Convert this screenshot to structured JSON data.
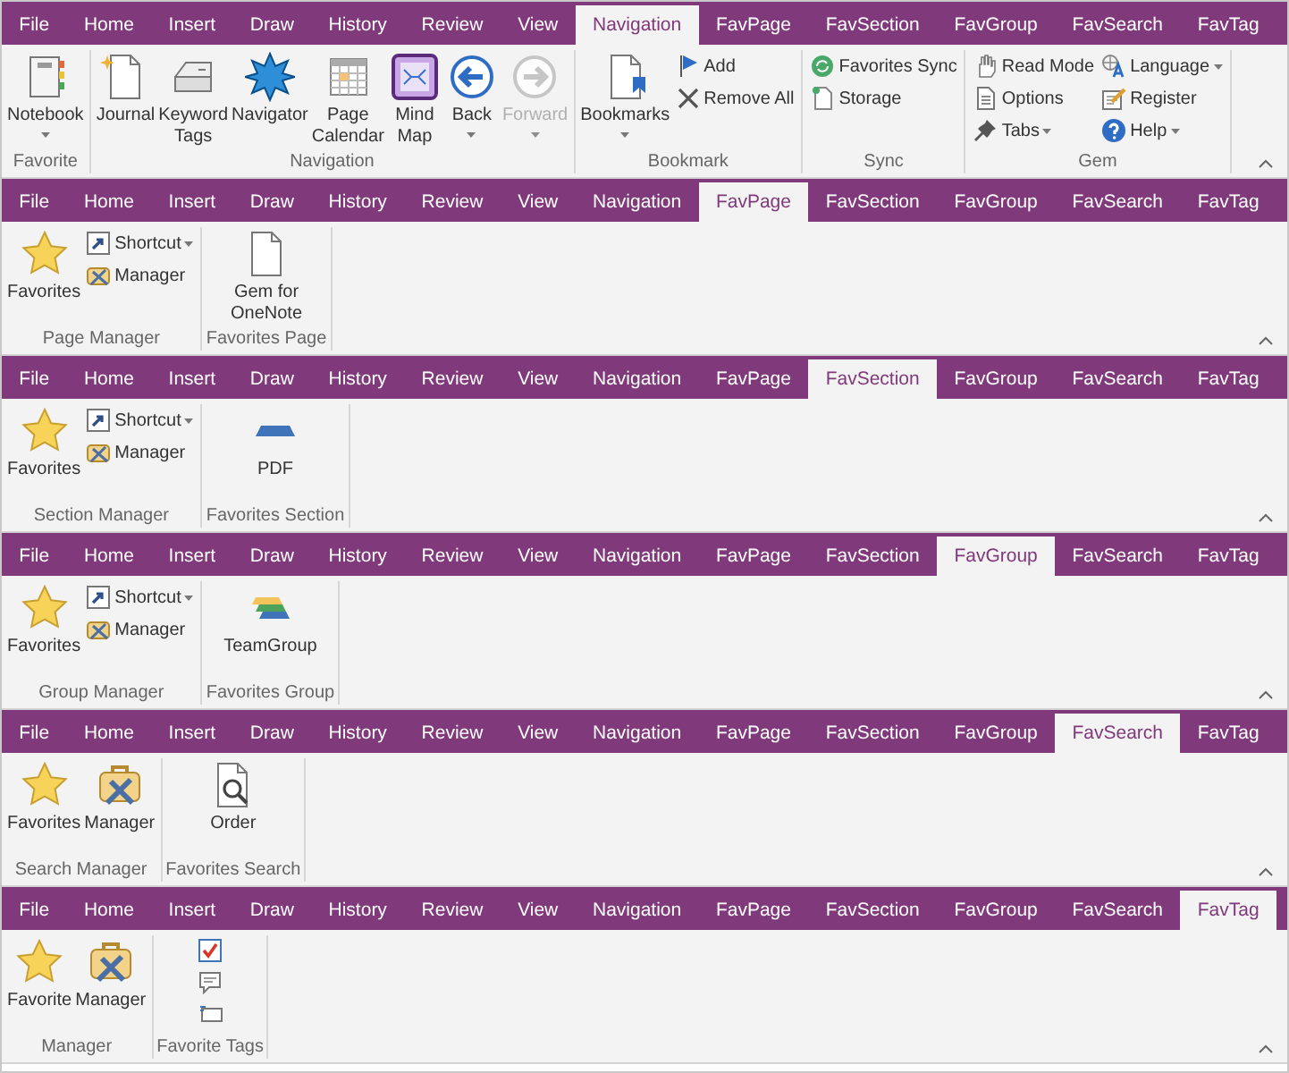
{
  "ribbons": [
    {
      "tabs": [
        {
          "label": "File",
          "selected": false
        },
        {
          "label": "Home",
          "selected": false
        },
        {
          "label": "Insert",
          "selected": false
        },
        {
          "label": "Draw",
          "selected": false
        },
        {
          "label": "History",
          "selected": false
        },
        {
          "label": "Review",
          "selected": false
        },
        {
          "label": "View",
          "selected": false
        },
        {
          "label": "Navigation",
          "selected": true
        },
        {
          "label": "FavPage",
          "selected": false
        },
        {
          "label": "FavSection",
          "selected": false
        },
        {
          "label": "FavGroup",
          "selected": false
        },
        {
          "label": "FavSearch",
          "selected": false
        },
        {
          "label": "FavTag",
          "selected": false
        }
      ],
      "groups": [
        {
          "title": "Favorite",
          "columns": [
            {
              "kind": "large",
              "items": [
                {
                  "label": "Notebook",
                  "dropdown": true,
                  "disabled": false
                }
              ]
            }
          ]
        },
        {
          "title": "Navigation",
          "columns": [
            {
              "kind": "large",
              "items": [
                {
                  "label": "Journal",
                  "dropdown": false,
                  "disabled": false
                }
              ]
            },
            {
              "kind": "large",
              "items": [
                {
                  "label": "Keyword\nTags",
                  "dropdown": false,
                  "disabled": false
                }
              ]
            },
            {
              "kind": "large",
              "items": [
                {
                  "label": "Navigator",
                  "dropdown": false,
                  "disabled": false
                }
              ]
            },
            {
              "kind": "large",
              "items": [
                {
                  "label": "Page\nCalendar",
                  "dropdown": false,
                  "disabled": false
                }
              ]
            },
            {
              "kind": "large",
              "items": [
                {
                  "label": "Mind\nMap",
                  "dropdown": false,
                  "disabled": false
                }
              ]
            },
            {
              "kind": "large",
              "items": [
                {
                  "label": "Back",
                  "dropdown": true,
                  "disabled": false
                }
              ]
            },
            {
              "kind": "large",
              "items": [
                {
                  "label": "Forward",
                  "dropdown": true,
                  "disabled": true
                }
              ]
            }
          ]
        },
        {
          "title": "Bookmark",
          "columns": [
            {
              "kind": "large",
              "items": [
                {
                  "label": "Bookmarks",
                  "dropdown": true,
                  "disabled": false
                }
              ]
            },
            {
              "kind": "stack",
              "items": [
                {
                  "label": "Add",
                  "dropdown": false,
                  "disabled": false
                },
                {
                  "label": "Remove All",
                  "dropdown": false,
                  "disabled": false
                }
              ]
            }
          ]
        },
        {
          "title": "Sync",
          "columns": [
            {
              "kind": "stack",
              "items": [
                {
                  "label": "Favorites Sync",
                  "dropdown": false,
                  "disabled": false
                },
                {
                  "label": "Storage",
                  "dropdown": false,
                  "disabled": false
                }
              ]
            }
          ]
        },
        {
          "title": "Gem",
          "columns": [
            {
              "kind": "stack",
              "items": [
                {
                  "label": "Read Mode",
                  "dropdown": false,
                  "disabled": false
                },
                {
                  "label": "Options",
                  "dropdown": false,
                  "disabled": false
                },
                {
                  "label": "Tabs",
                  "dropdown": true,
                  "disabled": false
                }
              ]
            },
            {
              "kind": "stack",
              "items": [
                {
                  "label": "Language",
                  "dropdown": true,
                  "disabled": false
                },
                {
                  "label": "Register",
                  "dropdown": false,
                  "disabled": false
                },
                {
                  "label": "Help",
                  "dropdown": true,
                  "disabled": false
                }
              ]
            }
          ]
        }
      ]
    },
    {
      "tabs": [
        {
          "label": "File",
          "selected": false
        },
        {
          "label": "Home",
          "selected": false
        },
        {
          "label": "Insert",
          "selected": false
        },
        {
          "label": "Draw",
          "selected": false
        },
        {
          "label": "History",
          "selected": false
        },
        {
          "label": "Review",
          "selected": false
        },
        {
          "label": "View",
          "selected": false
        },
        {
          "label": "Navigation",
          "selected": false
        },
        {
          "label": "FavPage",
          "selected": true
        },
        {
          "label": "FavSection",
          "selected": false
        },
        {
          "label": "FavGroup",
          "selected": false
        },
        {
          "label": "FavSearch",
          "selected": false
        },
        {
          "label": "FavTag",
          "selected": false
        }
      ],
      "groups": [
        {
          "title": "Page Manager",
          "columns": [
            {
              "kind": "large",
              "items": [
                {
                  "label": "Favorites",
                  "dropdown": false,
                  "disabled": false
                }
              ]
            },
            {
              "kind": "stack",
              "items": [
                {
                  "label": "Shortcut",
                  "dropdown": true,
                  "disabled": false
                },
                {
                  "label": "Manager",
                  "dropdown": false,
                  "disabled": false
                }
              ]
            }
          ]
        },
        {
          "title": "Favorites Page",
          "columns": [
            {
              "kind": "large",
              "items": [
                {
                  "label": "Gem for\nOneNote",
                  "dropdown": false,
                  "disabled": false
                }
              ]
            }
          ]
        }
      ]
    },
    {
      "tabs": [
        {
          "label": "File",
          "selected": false
        },
        {
          "label": "Home",
          "selected": false
        },
        {
          "label": "Insert",
          "selected": false
        },
        {
          "label": "Draw",
          "selected": false
        },
        {
          "label": "History",
          "selected": false
        },
        {
          "label": "Review",
          "selected": false
        },
        {
          "label": "View",
          "selected": false
        },
        {
          "label": "Navigation",
          "selected": false
        },
        {
          "label": "FavPage",
          "selected": false
        },
        {
          "label": "FavSection",
          "selected": true
        },
        {
          "label": "FavGroup",
          "selected": false
        },
        {
          "label": "FavSearch",
          "selected": false
        },
        {
          "label": "FavTag",
          "selected": false
        }
      ],
      "groups": [
        {
          "title": "Section Manager",
          "columns": [
            {
              "kind": "large",
              "items": [
                {
                  "label": "Favorites",
                  "dropdown": false,
                  "disabled": false
                }
              ]
            },
            {
              "kind": "stack",
              "items": [
                {
                  "label": "Shortcut",
                  "dropdown": true,
                  "disabled": false
                },
                {
                  "label": "Manager",
                  "dropdown": false,
                  "disabled": false
                }
              ]
            }
          ]
        },
        {
          "title": "Favorites Section",
          "columns": [
            {
              "kind": "large",
              "items": [
                {
                  "label": "PDF",
                  "dropdown": false,
                  "disabled": false
                }
              ]
            }
          ]
        }
      ]
    },
    {
      "tabs": [
        {
          "label": "File",
          "selected": false
        },
        {
          "label": "Home",
          "selected": false
        },
        {
          "label": "Insert",
          "selected": false
        },
        {
          "label": "Draw",
          "selected": false
        },
        {
          "label": "History",
          "selected": false
        },
        {
          "label": "Review",
          "selected": false
        },
        {
          "label": "View",
          "selected": false
        },
        {
          "label": "Navigation",
          "selected": false
        },
        {
          "label": "FavPage",
          "selected": false
        },
        {
          "label": "FavSection",
          "selected": false
        },
        {
          "label": "FavGroup",
          "selected": true
        },
        {
          "label": "FavSearch",
          "selected": false
        },
        {
          "label": "FavTag",
          "selected": false
        }
      ],
      "groups": [
        {
          "title": "Group Manager",
          "columns": [
            {
              "kind": "large",
              "items": [
                {
                  "label": "Favorites",
                  "dropdown": false,
                  "disabled": false
                }
              ]
            },
            {
              "kind": "stack",
              "items": [
                {
                  "label": "Shortcut",
                  "dropdown": true,
                  "disabled": false
                },
                {
                  "label": "Manager",
                  "dropdown": false,
                  "disabled": false
                }
              ]
            }
          ]
        },
        {
          "title": "Favorites Group",
          "columns": [
            {
              "kind": "large",
              "items": [
                {
                  "label": "TeamGroup",
                  "dropdown": false,
                  "disabled": false
                }
              ]
            }
          ]
        }
      ]
    },
    {
      "tabs": [
        {
          "label": "File",
          "selected": false
        },
        {
          "label": "Home",
          "selected": false
        },
        {
          "label": "Insert",
          "selected": false
        },
        {
          "label": "Draw",
          "selected": false
        },
        {
          "label": "History",
          "selected": false
        },
        {
          "label": "Review",
          "selected": false
        },
        {
          "label": "View",
          "selected": false
        },
        {
          "label": "Navigation",
          "selected": false
        },
        {
          "label": "FavPage",
          "selected": false
        },
        {
          "label": "FavSection",
          "selected": false
        },
        {
          "label": "FavGroup",
          "selected": false
        },
        {
          "label": "FavSearch",
          "selected": true
        },
        {
          "label": "FavTag",
          "selected": false
        }
      ],
      "groups": [
        {
          "title": "Search Manager",
          "columns": [
            {
              "kind": "large",
              "items": [
                {
                  "label": "Favorites",
                  "dropdown": false,
                  "disabled": false
                }
              ]
            },
            {
              "kind": "large",
              "items": [
                {
                  "label": "Manager",
                  "dropdown": false,
                  "disabled": false
                }
              ]
            }
          ]
        },
        {
          "title": "Favorites Search",
          "columns": [
            {
              "kind": "large",
              "items": [
                {
                  "label": "Order",
                  "dropdown": false,
                  "disabled": false
                }
              ]
            }
          ]
        }
      ]
    },
    {
      "tabs": [
        {
          "label": "File",
          "selected": false
        },
        {
          "label": "Home",
          "selected": false
        },
        {
          "label": "Insert",
          "selected": false
        },
        {
          "label": "Draw",
          "selected": false
        },
        {
          "label": "History",
          "selected": false
        },
        {
          "label": "Review",
          "selected": false
        },
        {
          "label": "View",
          "selected": false
        },
        {
          "label": "Navigation",
          "selected": false
        },
        {
          "label": "FavPage",
          "selected": false
        },
        {
          "label": "FavSection",
          "selected": false
        },
        {
          "label": "FavGroup",
          "selected": false
        },
        {
          "label": "FavSearch",
          "selected": false
        },
        {
          "label": "FavTag",
          "selected": true
        }
      ],
      "groups": [
        {
          "title": "Manager",
          "columns": [
            {
              "kind": "large",
              "items": [
                {
                  "label": "Favorite",
                  "dropdown": false,
                  "disabled": false
                }
              ]
            },
            {
              "kind": "large",
              "items": [
                {
                  "label": "Manager",
                  "dropdown": false,
                  "disabled": false
                }
              ]
            }
          ]
        },
        {
          "title": "Favorite Tags",
          "columns": [
            {
              "kind": "icons",
              "items": [
                {
                  "kind": "checkbox",
                  "checked": true
                },
                {
                  "kind": "comment"
                },
                {
                  "kind": "card"
                }
              ]
            }
          ]
        }
      ]
    }
  ]
}
